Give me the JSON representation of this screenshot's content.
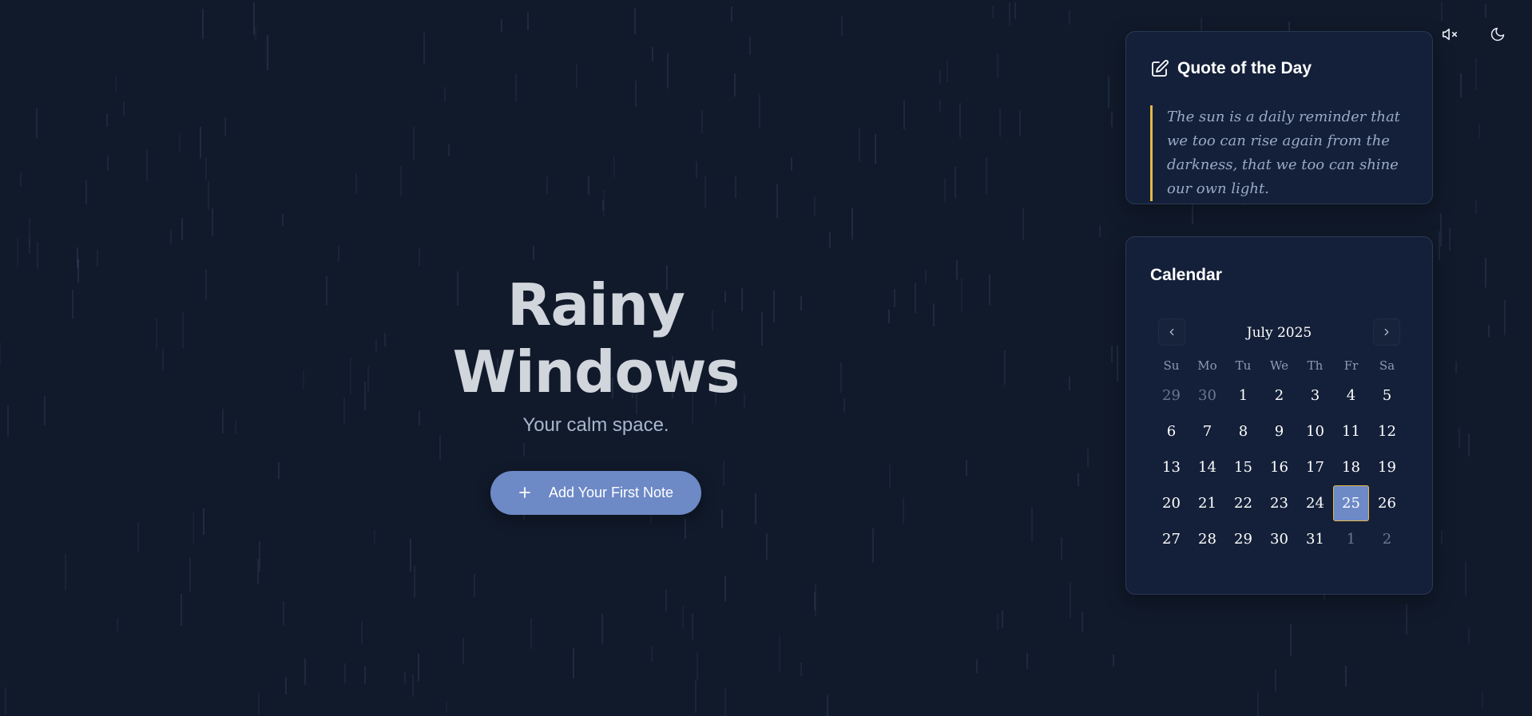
{
  "hero": {
    "title": "Rainy Windows",
    "subtitle": "Your calm space.",
    "add_note_label": "Add Your First Note",
    "add_note_icon": "plus-icon"
  },
  "top_icons": {
    "mute": "volume-mute-icon",
    "theme": "moon-icon"
  },
  "quote": {
    "heading": "Quote of the Day",
    "icon": "edit-icon",
    "text": "The sun is a daily reminder that we too can rise again from the darkness, that we too can shine our own light."
  },
  "calendar": {
    "heading": "Calendar",
    "month_label": "July 2025",
    "prev_icon": "chevron-left-icon",
    "next_icon": "chevron-right-icon",
    "weekdays": [
      "Su",
      "Mo",
      "Tu",
      "We",
      "Th",
      "Fr",
      "Sa"
    ],
    "days": [
      {
        "label": "29",
        "muted": true
      },
      {
        "label": "30",
        "muted": true
      },
      {
        "label": "1"
      },
      {
        "label": "2"
      },
      {
        "label": "3"
      },
      {
        "label": "4"
      },
      {
        "label": "5"
      },
      {
        "label": "6"
      },
      {
        "label": "7"
      },
      {
        "label": "8"
      },
      {
        "label": "9"
      },
      {
        "label": "10"
      },
      {
        "label": "11"
      },
      {
        "label": "12"
      },
      {
        "label": "13"
      },
      {
        "label": "14"
      },
      {
        "label": "15"
      },
      {
        "label": "16"
      },
      {
        "label": "17"
      },
      {
        "label": "18"
      },
      {
        "label": "19"
      },
      {
        "label": "20"
      },
      {
        "label": "21"
      },
      {
        "label": "22"
      },
      {
        "label": "23"
      },
      {
        "label": "24"
      },
      {
        "label": "25",
        "today": true
      },
      {
        "label": "26"
      },
      {
        "label": "27"
      },
      {
        "label": "28"
      },
      {
        "label": "29"
      },
      {
        "label": "30"
      },
      {
        "label": "31"
      },
      {
        "label": "1",
        "muted": true
      },
      {
        "label": "2",
        "muted": true
      }
    ]
  },
  "colors": {
    "background": "#111a2b",
    "panel": "#142039",
    "accent": "#6d89c6",
    "quote_border": "#e6b84a"
  }
}
